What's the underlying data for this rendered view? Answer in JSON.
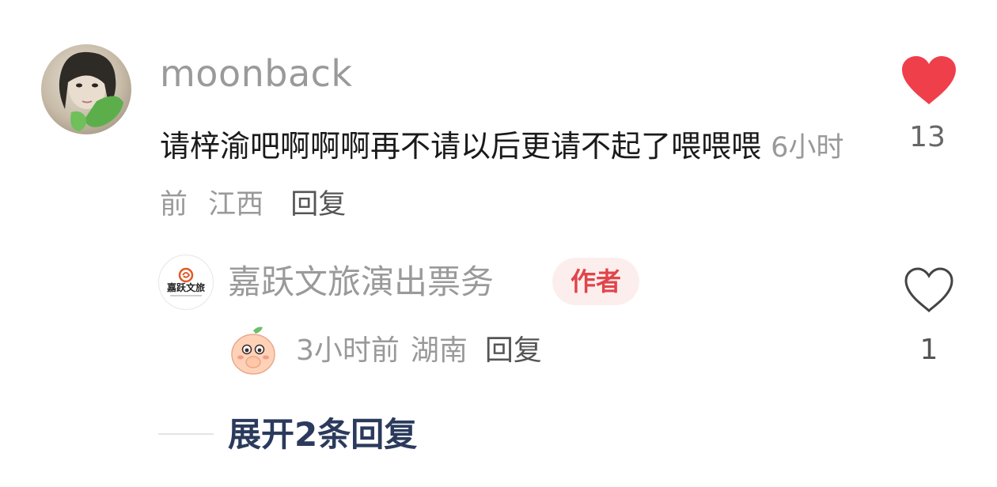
{
  "comment": {
    "username": "moonback",
    "text": "请梓渝吧啊啊啊再不请以后更请不起了喂喂喂",
    "time": "6小时前",
    "location": "江西",
    "reply_label": "回复",
    "like_count": "13",
    "liked": true,
    "like_color": "#ef3f4b"
  },
  "reply": {
    "author": "嘉跃文旅演出票务",
    "author_badge": "作者",
    "avatar_text": "嘉跃文旅",
    "sticker_icon": "peach-cover-mouth-sticker-icon",
    "time": "3小时前",
    "location": "湖南",
    "reply_label": "回复",
    "like_count": "1",
    "liked": false
  },
  "expand": {
    "label": "展开2条回复"
  }
}
